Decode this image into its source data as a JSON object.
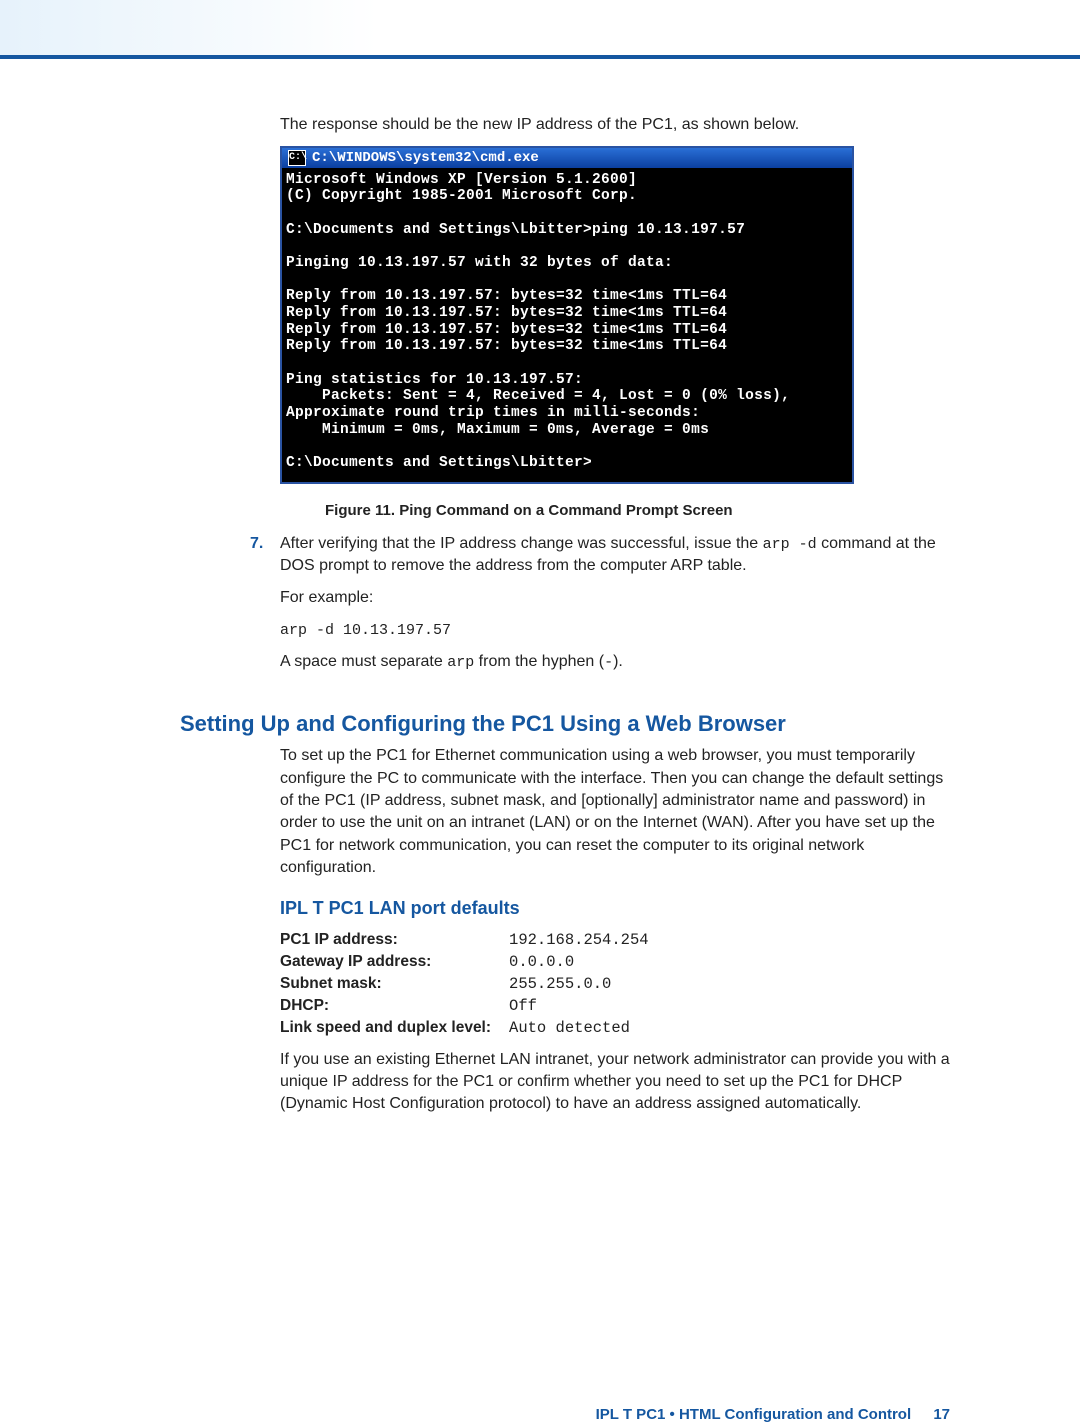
{
  "intro_line": "The response should be the new IP address of the PC1, as shown below.",
  "cmd": {
    "title_prefix": "C:\\",
    "title": "C:\\WINDOWS\\system32\\cmd.exe",
    "body": "Microsoft Windows XP [Version 5.1.2600]\n(C) Copyright 1985-2001 Microsoft Corp.\n\nC:\\Documents and Settings\\Lbitter>ping 10.13.197.57\n\nPinging 10.13.197.57 with 32 bytes of data:\n\nReply from 10.13.197.57: bytes=32 time<1ms TTL=64\nReply from 10.13.197.57: bytes=32 time<1ms TTL=64\nReply from 10.13.197.57: bytes=32 time<1ms TTL=64\nReply from 10.13.197.57: bytes=32 time<1ms TTL=64\n\nPing statistics for 10.13.197.57:\n    Packets: Sent = 4, Received = 4, Lost = 0 (0% loss),\nApproximate round trip times in milli-seconds:\n    Minimum = 0ms, Maximum = 0ms, Average = 0ms\n\nC:\\Documents and Settings\\Lbitter>"
  },
  "figure_caption": "Figure 11.  Ping Command on a Command Prompt Screen",
  "step7": {
    "num": "7.",
    "line1_a": "After verifying that the IP address change was successful, issue the ",
    "code1": "arp -d",
    "line1_b": " command at the DOS prompt to remove the address from the computer ARP table.",
    "para2": "For example:",
    "code2": "arp -d 10.13.197.57",
    "para3_a": "A space must separate ",
    "code3": "arp",
    "para3_b": " from the hyphen (",
    "code4": "-",
    "para3_c": ")."
  },
  "section_heading": "Setting Up and Configuring the PC1 Using a Web Browser",
  "section_body": "To set up the PC1 for Ethernet communication using a web browser, you must temporarily configure the PC to communicate with the interface. Then you can change the default settings of the PC1 (IP address, subnet mask, and [optionally] administrator name and password) in order to use the unit on an intranet (LAN) or on the Internet (WAN). After you have set up the PC1 for network communication, you can reset the computer to its original network configuration.",
  "sub_heading": "IPL T PC1 LAN port defaults",
  "defaults": [
    {
      "label": "PC1 IP address:",
      "value": "192.168.254.254"
    },
    {
      "label": "Gateway IP address:",
      "value": "0.0.0.0"
    },
    {
      "label": "Subnet mask:",
      "value": "255.255.0.0"
    },
    {
      "label": "DHCP:",
      "value": "Off"
    },
    {
      "label": "Link speed and duplex level:",
      "value": "Auto detected"
    }
  ],
  "closing_para": "If you use an existing Ethernet LAN intranet, your network administrator can provide you with a unique IP address for the PC1 or confirm whether you need to set up the PC1 for DHCP (Dynamic Host Configuration protocol) to have an address assigned automatically.",
  "footer": {
    "text": "IPL T PC1 • HTML Configuration and Control",
    "page": "17"
  }
}
